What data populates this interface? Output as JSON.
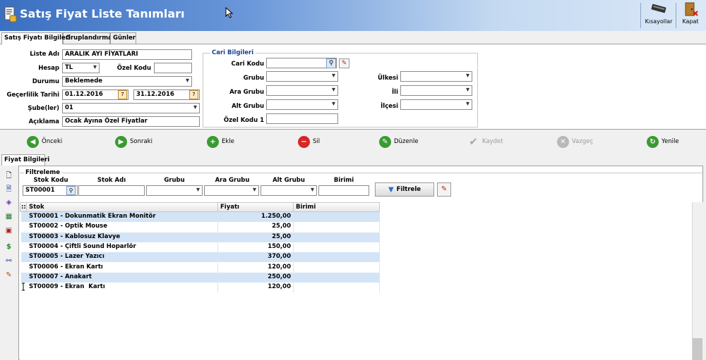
{
  "window": {
    "title": "Satış Fiyat Liste Tanımları",
    "buttons": {
      "shortcuts": "Kısayollar",
      "close": "Kapat"
    }
  },
  "tabs": [
    "Satış Fiyatı Bilgileri",
    "Gruplandırma",
    "Günler"
  ],
  "form": {
    "liste_adi": {
      "label": "Liste Adı",
      "value": "ARALIK AYI FİYATLARI"
    },
    "hesap": {
      "label": "Hesap",
      "value": "TL"
    },
    "ozel_kodu": {
      "label": "Özel Kodu",
      "value": ""
    },
    "durumu": {
      "label": "Durumu",
      "value": "Beklemede"
    },
    "gecerlilik": {
      "label": "Geçerlilik Tarihi",
      "from": "01.12.2016",
      "to": "31.12.2016"
    },
    "subeler": {
      "label": "Şube(ler)",
      "value": "01"
    },
    "aciklama": {
      "label": "Açıklama",
      "value": "Ocak Ayına Özel Fiyatlar"
    }
  },
  "cari": {
    "title": "Cari Bilgileri",
    "cari_kodu": "Cari Kodu",
    "grubu": "Grubu",
    "ara_grubu": "Ara Grubu",
    "alt_grubu": "Alt Grubu",
    "ozel_kodu_1": "Özel Kodu 1",
    "ulkesi": "Ülkesi",
    "ili": "İli",
    "ilcesi": "İlçesi"
  },
  "toolbar": {
    "onceki": "Önceki",
    "sonraki": "Sonraki",
    "ekle": "Ekle",
    "sil": "Sil",
    "duzenle": "Düzenle",
    "kaydet": "Kaydet",
    "vazgec": "Vazgeç",
    "yenile": "Yenile"
  },
  "detail_tab": "Fiyat Bilgileri",
  "filter": {
    "title": "Filtreleme",
    "headers": [
      "Stok Kodu",
      "Stok Adı",
      "Grubu",
      "Ara Grubu",
      "Alt Grubu",
      "Birimi"
    ],
    "stok_kodu_value": "ST00001",
    "button": "Filtrele"
  },
  "grid": {
    "columns": [
      "Stok",
      "Fiyatı",
      "Birimi"
    ],
    "rows": [
      {
        "stok": "ST00001 - Dokunmatik Ekran Monitör",
        "fiyat": "1.250,00",
        "birim": ""
      },
      {
        "stok": "ST00002 - Optik Mouse",
        "fiyat": "25,00",
        "birim": ""
      },
      {
        "stok": "ST00003 - Kablosuz Klavye",
        "fiyat": "25,00",
        "birim": ""
      },
      {
        "stok": "ST00004 - Çiftli Sound Hoparlör",
        "fiyat": "150,00",
        "birim": ""
      },
      {
        "stok": "ST00005 - Lazer Yazıcı",
        "fiyat": "370,00",
        "birim": ""
      },
      {
        "stok": "ST00006 - Ekran Kartı",
        "fiyat": "120,00",
        "birim": ""
      },
      {
        "stok": "ST00007 - Anakart",
        "fiyat": "250,00",
        "birim": ""
      },
      {
        "stok": "ST00009 - Ekran  Kartı",
        "fiyat": "120,00",
        "birim": ""
      }
    ]
  },
  "colors": {
    "header_start": "#3a6fc1",
    "row_alt": "#d4e4f7",
    "cari_title": "#1c3f94"
  }
}
